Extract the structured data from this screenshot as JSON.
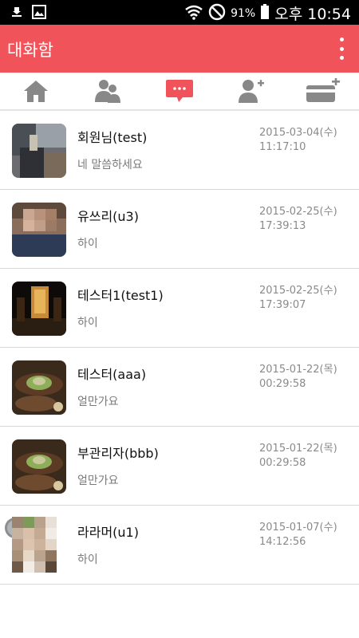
{
  "status_bar": {
    "battery": "91%",
    "time": "오후 10:54"
  },
  "app_bar": {
    "title": "대화함"
  },
  "tabs": [
    {
      "icon": "home-icon"
    },
    {
      "icon": "friends-icon"
    },
    {
      "icon": "chat-icon"
    },
    {
      "icon": "add-friend-icon"
    },
    {
      "icon": "card-add-icon"
    }
  ],
  "colors": {
    "accent": "#f0545a",
    "tab_icon": "#888888"
  },
  "conversations": [
    {
      "name": "회원님(test)",
      "message": "네 말씀하세요",
      "date": "2015-03-04(수)",
      "time": "11:17:10"
    },
    {
      "name": "유쓰리(u3)",
      "message": "하이",
      "date": "2015-02-25(수)",
      "time": "17:39:13"
    },
    {
      "name": "테스터1(test1)",
      "message": "하이",
      "date": "2015-02-25(수)",
      "time": "17:39:07"
    },
    {
      "name": "테스터(aaa)",
      "message": "얼만가요",
      "date": "2015-01-22(목)",
      "time": "00:29:58"
    },
    {
      "name": "부관리자(bbb)",
      "message": "얼만가요",
      "date": "2015-01-22(목)",
      "time": "00:29:58"
    },
    {
      "name": "라라머(u1)",
      "message": "하이",
      "date": "2015-01-07(수)",
      "time": "14:12:56"
    }
  ]
}
